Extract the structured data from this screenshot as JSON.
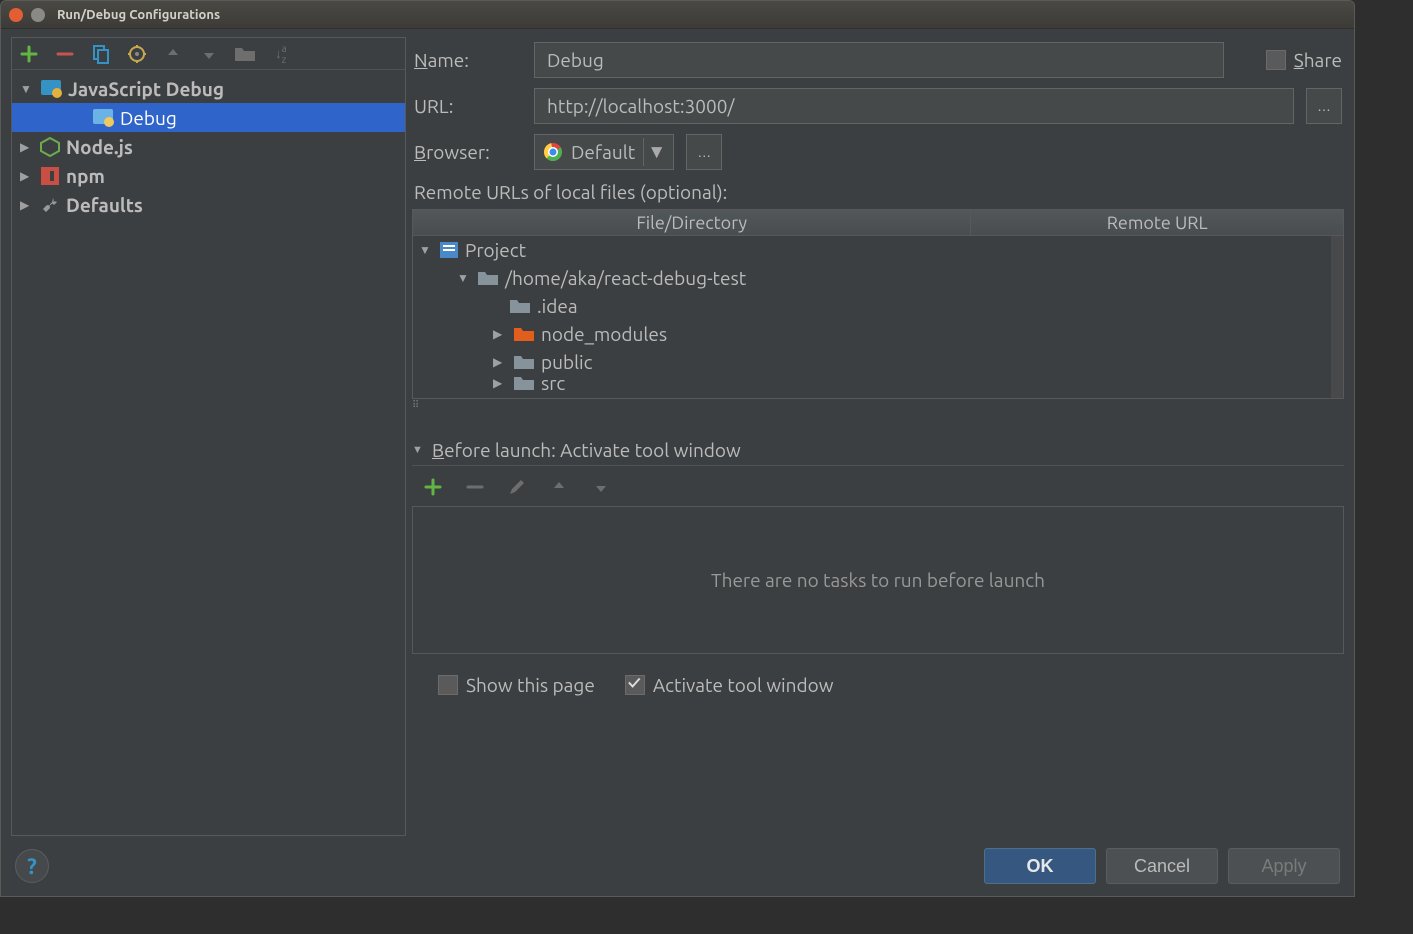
{
  "window": {
    "title": "Run/Debug Configurations"
  },
  "sidebar": {
    "tree": [
      {
        "label": "JavaScript Debug",
        "expanded": true,
        "children": [
          {
            "label": "Debug",
            "selected": true
          }
        ]
      },
      {
        "label": "Node.js",
        "expanded": false
      },
      {
        "label": "npm",
        "expanded": false
      },
      {
        "label": "Defaults",
        "expanded": false
      }
    ]
  },
  "form": {
    "name_label": "Name:",
    "name_value": "Debug",
    "share_label": "Share",
    "url_label": "URL:",
    "url_value": "http://localhost:3000/",
    "browser_label": "Browser:",
    "browser_value": "Default"
  },
  "remote": {
    "header": "Remote URLs of local files (optional):",
    "col1": "File/Directory",
    "col2": "Remote URL",
    "tree": {
      "root": "Project",
      "path": "/home/aka/react-debug-test",
      "children": [
        {
          "name": ".idea",
          "expanded": null,
          "color": "gray"
        },
        {
          "name": "node_modules",
          "expanded": false,
          "color": "orange"
        },
        {
          "name": "public",
          "expanded": false,
          "color": "gray"
        },
        {
          "name": "src",
          "expanded": false,
          "color": "gray",
          "cut": true
        }
      ]
    }
  },
  "before_launch": {
    "label": "Before launch: Activate tool window",
    "empty": "There are no tasks to run before launch",
    "show_page": "Show this page",
    "activate": "Activate tool window",
    "show_page_checked": false,
    "activate_checked": true
  },
  "buttons": {
    "ok": "OK",
    "cancel": "Cancel",
    "apply": "Apply"
  }
}
